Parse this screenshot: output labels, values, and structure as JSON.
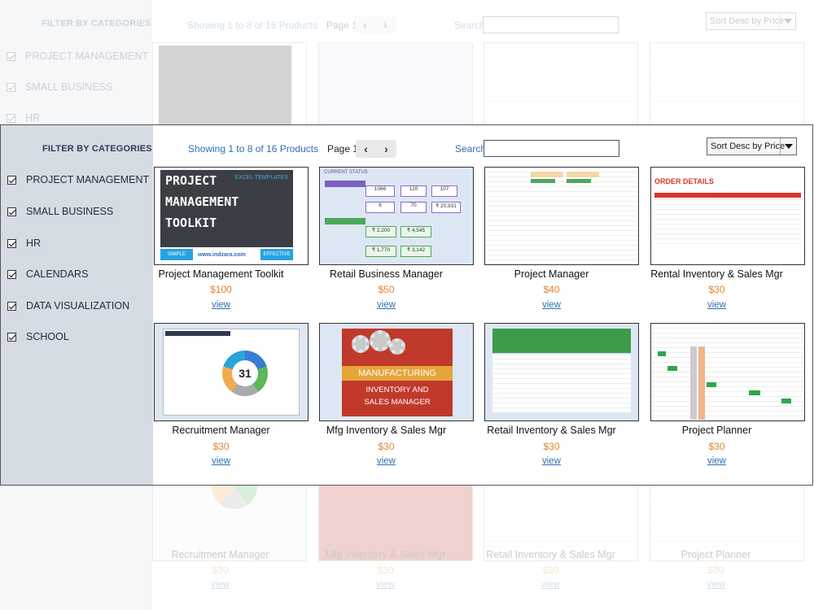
{
  "sidebar": {
    "title": "FILTER BY CATEGORIES",
    "categories": [
      "PROJECT MANAGEMENT",
      "SMALL BUSINESS",
      "HR",
      "CALENDARS",
      "DATA VISUALIZATION",
      "SCHOOL"
    ],
    "checked": [
      true,
      true,
      true,
      true,
      true,
      true
    ]
  },
  "toolbar": {
    "showing": "Showing 1 to 8 of 16 Products",
    "page_label": "Page 1",
    "search_label": "Search",
    "search_value": "",
    "sort_value": "Sort Desc by Price"
  },
  "products": [
    {
      "name": "Project Management Toolkit",
      "price": "$100",
      "link": "view"
    },
    {
      "name": "Retail Business Manager",
      "price": "$50",
      "link": "view"
    },
    {
      "name": "Project Manager",
      "price": "$40",
      "link": "view"
    },
    {
      "name": "Rental Inventory & Sales Mgr",
      "price": "$30",
      "link": "view"
    },
    {
      "name": "Recruitment Manager",
      "price": "$30",
      "link": "view"
    },
    {
      "name": "Mfg Inventory & Sales Mgr",
      "price": "$30",
      "link": "view"
    },
    {
      "name": "Retail Inventory & Sales Mgr",
      "price": "$30",
      "link": "view"
    },
    {
      "name": "Project Planner",
      "price": "$30",
      "link": "view"
    }
  ],
  "colors": {
    "sidebar_bg": "#d6dce4",
    "link_blue": "#2e6eb1",
    "price_orange": "#e6822b"
  }
}
